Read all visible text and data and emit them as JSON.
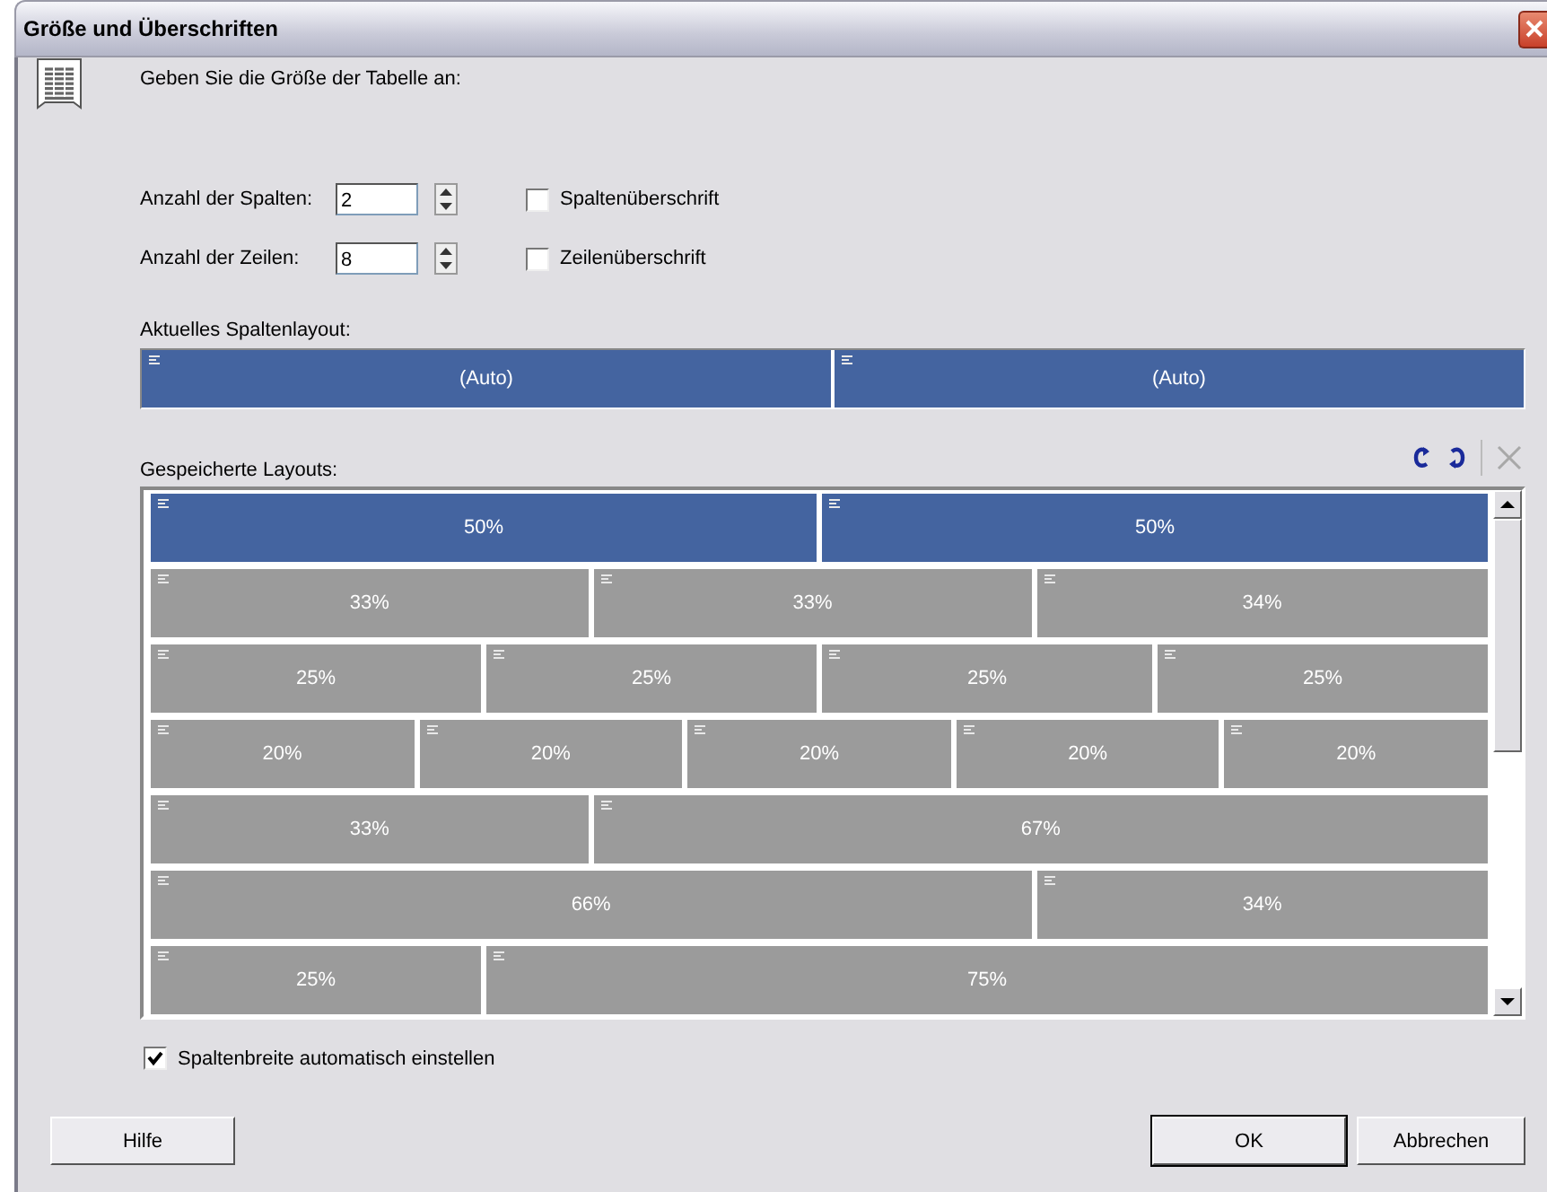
{
  "window": {
    "title": "Größe und Überschriften"
  },
  "prompt": "Geben Sie die Größe der Tabelle an:",
  "size_fields": [
    {
      "label": "Anzahl der Spalten:",
      "value": "2",
      "checkbox": {
        "label": "Spaltenüberschrift",
        "checked": false
      }
    },
    {
      "label": "Anzahl der Zeilen:",
      "value": "8",
      "checkbox": {
        "label": "Zeilenüberschrift",
        "checked": false
      }
    }
  ],
  "current_layout": {
    "label": "Aktuelles Spaltenlayout:",
    "columns": [
      "(Auto)",
      "(Auto)"
    ]
  },
  "saved_layouts": {
    "label": "Gespeicherte Layouts:",
    "toolbar": [
      {
        "kind": "rotate-left",
        "disabled": false
      },
      {
        "kind": "rotate-right",
        "disabled": false
      },
      {
        "kind": "delete",
        "disabled": true
      }
    ],
    "rows": [
      {
        "selected": true,
        "columns": [
          "50%",
          "50%"
        ]
      },
      {
        "selected": false,
        "columns": [
          "33%",
          "33%",
          "34%"
        ]
      },
      {
        "selected": false,
        "columns": [
          "25%",
          "25%",
          "25%",
          "25%"
        ]
      },
      {
        "selected": false,
        "columns": [
          "20%",
          "20%",
          "20%",
          "20%",
          "20%"
        ]
      },
      {
        "selected": false,
        "columns": [
          "33%",
          "67%"
        ]
      },
      {
        "selected": false,
        "columns": [
          "66%",
          "34%"
        ]
      },
      {
        "selected": false,
        "columns": [
          "25%",
          "75%"
        ]
      }
    ]
  },
  "auto_width": {
    "label": "Spaltenbreite automatisch einstellen",
    "checked": true
  },
  "buttons": [
    {
      "label": "Hilfe",
      "kind": "help"
    },
    {
      "label": "OK",
      "kind": "ok"
    },
    {
      "label": "Abbrechen",
      "kind": "cancel"
    }
  ]
}
